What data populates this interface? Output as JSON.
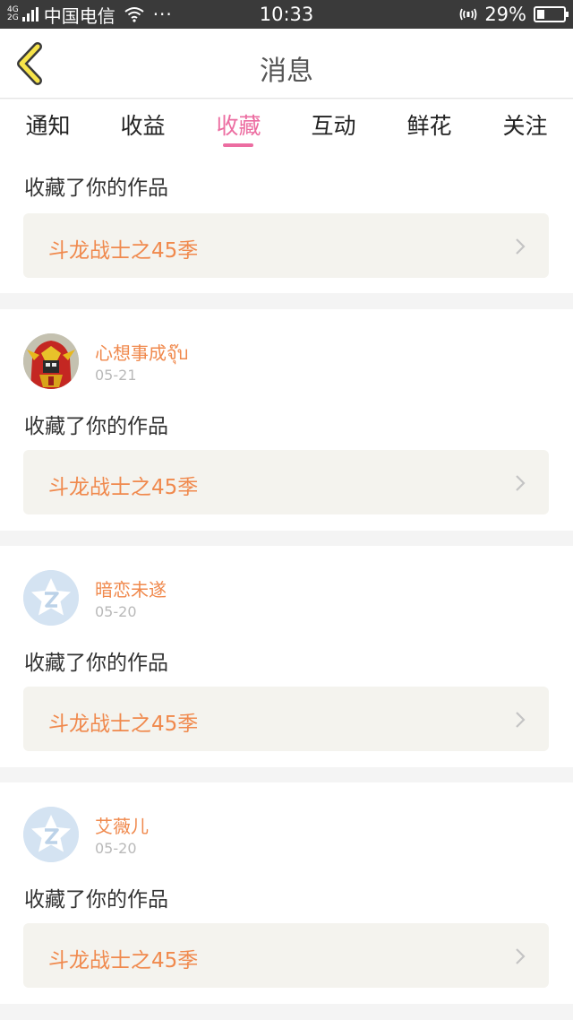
{
  "status_bar": {
    "net_top": "4G",
    "net_bottom": "2G",
    "carrier": "中国电信",
    "more": "···",
    "time": "10:33",
    "battery_percent": "29%",
    "battery_level": 0.29,
    "icons": [
      "signal-icon",
      "wifi-icon",
      "nfc-icon",
      "battery-icon"
    ]
  },
  "header": {
    "title": "消息",
    "back_icon": "chevron-left-icon"
  },
  "tabs": [
    {
      "label": "通知",
      "active": false
    },
    {
      "label": "收益",
      "active": false
    },
    {
      "label": "收藏",
      "active": true
    },
    {
      "label": "互动",
      "active": false
    },
    {
      "label": "鲜花",
      "active": false
    },
    {
      "label": "关注",
      "active": false
    }
  ],
  "colors": {
    "accent_pink": "#ec6da1",
    "name_orange": "#f0894d",
    "status_bar_bg": "#3a3a3a",
    "work_box_bg": "#f4f3ee"
  },
  "items": [
    {
      "user": "",
      "date": "",
      "action": "收藏了你的作品",
      "work": "斗龙战士之45季",
      "avatar": "none"
    },
    {
      "user": "心想事成จุ๊บ",
      "date": "05-21",
      "action": "收藏了你的作品",
      "work": "斗龙战士之45季",
      "avatar": "robot-avatar"
    },
    {
      "user": "暗恋未遂",
      "date": "05-20",
      "action": "收藏了你的作品",
      "work": "斗龙战士之45季",
      "avatar": "default-avatar"
    },
    {
      "user": "艾薇儿",
      "date": "05-20",
      "action": "收藏了你的作品",
      "work": "斗龙战士之45季",
      "avatar": "default-avatar"
    }
  ]
}
